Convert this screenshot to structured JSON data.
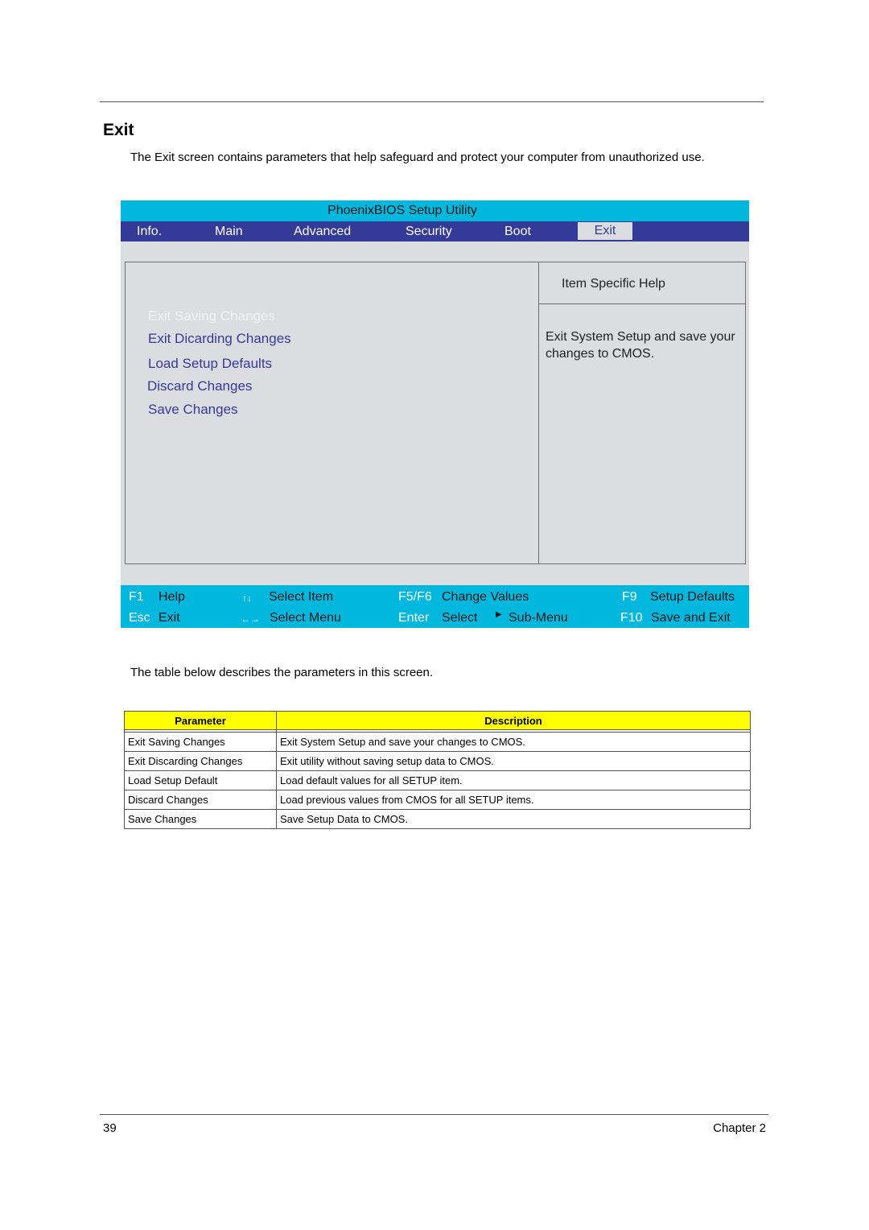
{
  "page": {
    "title": "Exit",
    "intro": "The Exit screen contains parameters that help safeguard and protect your computer from unauthorized use.",
    "table_intro": "The table below describes the parameters in this screen.",
    "page_number": "39",
    "chapter": "Chapter 2"
  },
  "bios": {
    "title": "PhoenixBIOS Setup Utility",
    "tabs": [
      {
        "label": "Info."
      },
      {
        "label": "Main"
      },
      {
        "label": "Advanced"
      },
      {
        "label": "Security"
      },
      {
        "label": "Boot"
      },
      {
        "label": "Exit",
        "active": true
      }
    ],
    "items": [
      {
        "label": "Exit Saving Changes",
        "selected": true
      },
      {
        "label": "Exit Dicarding Changes"
      },
      {
        "label": "Load Setup Defaults"
      },
      {
        "label": "Discard Changes"
      },
      {
        "label": "Save Changes"
      }
    ],
    "help": {
      "title": "Item Specific Help",
      "text": "Exit System Setup and save your changes to CMOS."
    },
    "footer": {
      "row1": [
        {
          "key": "F1",
          "desc": "Help"
        },
        {
          "key": "↑↓",
          "desc": "Select Item"
        },
        {
          "key": "F5/F6",
          "desc": "Change Values"
        },
        {
          "key": "F9",
          "desc": "Setup Defaults"
        }
      ],
      "row2": [
        {
          "key": "Esc",
          "desc": "Exit"
        },
        {
          "key": "←→",
          "desc": "Select Menu"
        },
        {
          "key": "Enter",
          "desc": "Select",
          "glyph": "▶",
          "desc2": "Sub-Menu"
        },
        {
          "key": "F10",
          "desc": "Save and Exit"
        }
      ]
    },
    "colors": {
      "title_bar": "#00b7de",
      "menu_bar": "#333a97",
      "panel": "#dcdde0",
      "item_text": "#333a97"
    }
  },
  "table": {
    "headers": [
      "Parameter",
      "Description"
    ],
    "header_color": "#ffff00",
    "rows": [
      [
        "Exit Saving Changes",
        "Exit System Setup and save your changes to CMOS."
      ],
      [
        "Exit Discarding Changes",
        "Exit utility without saving setup data to CMOS."
      ],
      [
        "Load Setup Default",
        "Load default values for all SETUP item."
      ],
      [
        "Discard Changes",
        "Load previous values from CMOS for all SETUP items."
      ],
      [
        "Save Changes",
        "Save Setup Data to CMOS."
      ]
    ]
  }
}
